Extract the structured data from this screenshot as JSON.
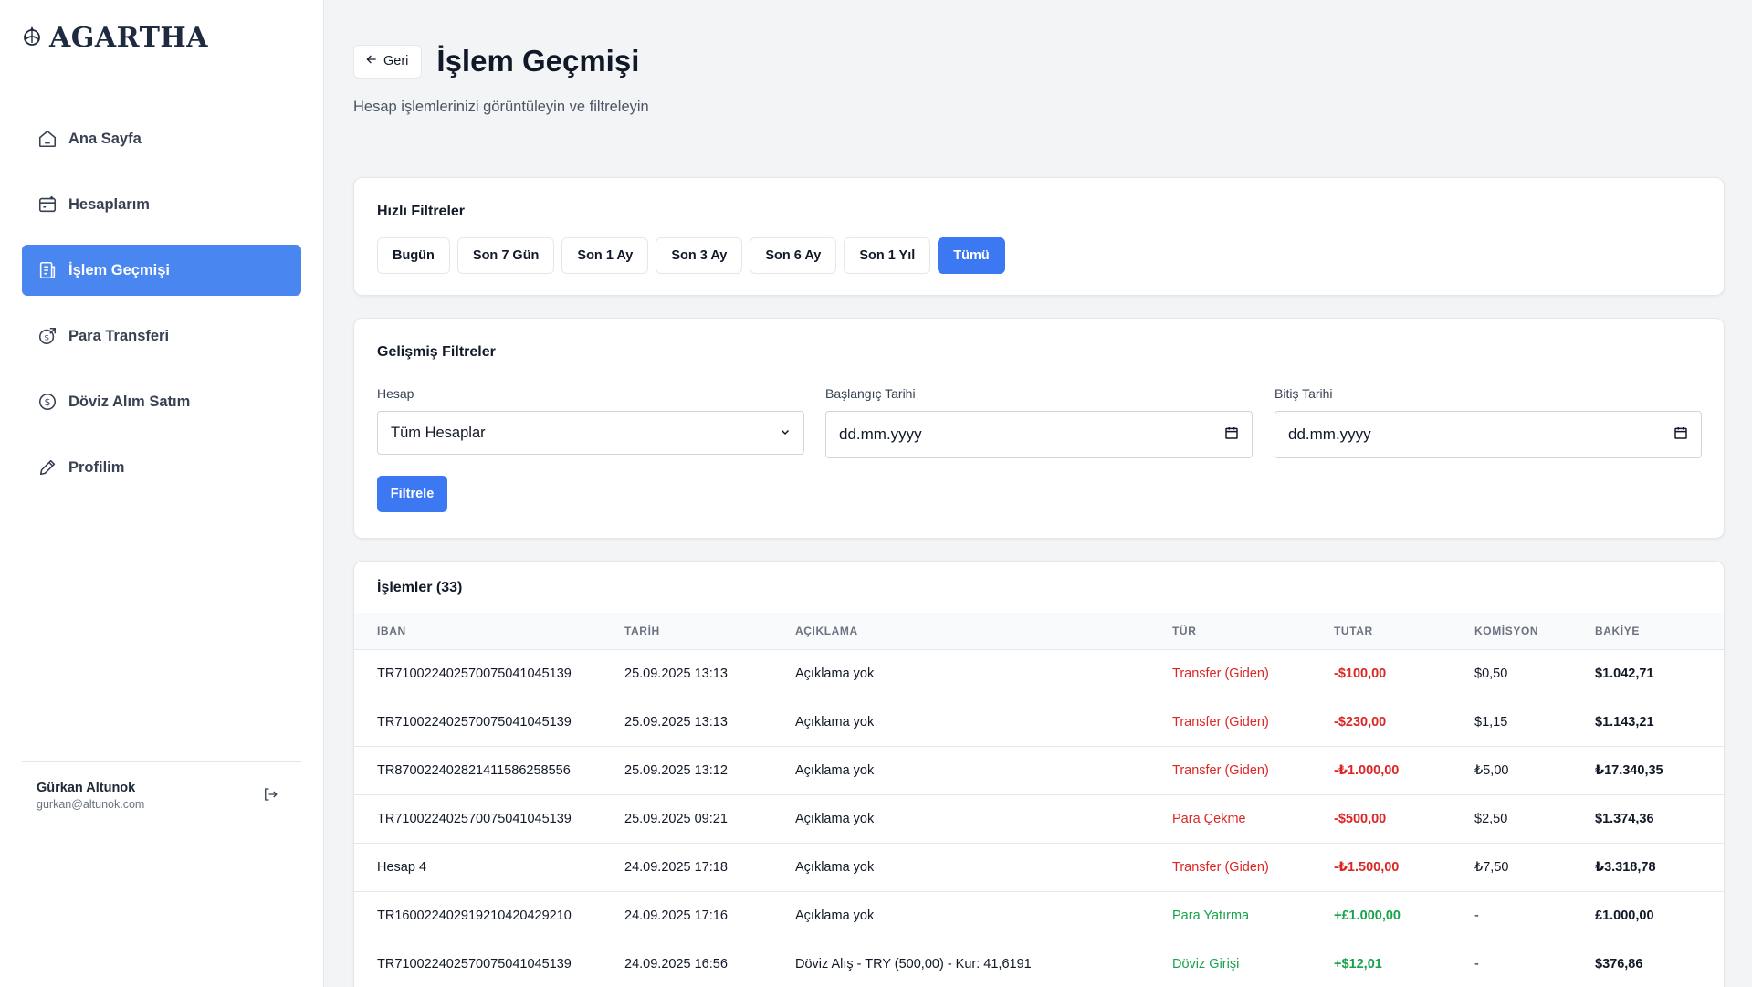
{
  "brand": {
    "name": "AGARTHA"
  },
  "sidebar": {
    "items": [
      {
        "label": "Ana Sayfa",
        "icon": "home-icon",
        "active": false
      },
      {
        "label": "Hesaplarım",
        "icon": "accounts-icon",
        "active": false
      },
      {
        "label": "İşlem Geçmişi",
        "icon": "receipt-icon",
        "active": true
      },
      {
        "label": "Para Transferi",
        "icon": "transfer-icon",
        "active": false
      },
      {
        "label": "Döviz Alım Satım",
        "icon": "dollar-icon",
        "active": false
      },
      {
        "label": "Profilim",
        "icon": "pencil-icon",
        "active": false
      }
    ]
  },
  "user": {
    "name": "Gürkan Altunok",
    "email": "gurkan@altunok.com"
  },
  "header": {
    "back_label": "Geri",
    "title": "İşlem Geçmişi",
    "subtitle": "Hesap işlemlerinizi görüntüleyin ve filtreleyin"
  },
  "quick_filters": {
    "title": "Hızlı Filtreler",
    "buttons": [
      "Bugün",
      "Son 7 Gün",
      "Son 1 Ay",
      "Son 3 Ay",
      "Son 6 Ay",
      "Son 1 Yıl",
      "Tümü"
    ],
    "selected": "Tümü"
  },
  "advanced_filters": {
    "title": "Gelişmiş Filtreler",
    "account_label": "Hesap",
    "account_value": "Tüm Hesaplar",
    "start_label": "Başlangıç Tarihi",
    "start_value": "dd.mm.yyyy",
    "end_label": "Bitiş Tarihi",
    "end_value": "dd.mm.yyyy",
    "submit_label": "Filtrele"
  },
  "transactions": {
    "title": "İşlemler (33)",
    "columns": [
      "IBAN",
      "TARİH",
      "AÇIKLAMA",
      "TÜR",
      "TUTAR",
      "KOMİSYON",
      "BAKİYE"
    ],
    "rows": [
      {
        "iban": "TR710022402570075041045139",
        "date": "25.09.2025 13:13",
        "desc": "Açıklama yok",
        "type": "Transfer (Giden)",
        "amount": "-$100,00",
        "fee": "$0,50",
        "balance": "$1.042,71",
        "direction": "out"
      },
      {
        "iban": "TR710022402570075041045139",
        "date": "25.09.2025 13:13",
        "desc": "Açıklama yok",
        "type": "Transfer (Giden)",
        "amount": "-$230,00",
        "fee": "$1,15",
        "balance": "$1.143,21",
        "direction": "out"
      },
      {
        "iban": "TR870022402821411586258556",
        "date": "25.09.2025 13:12",
        "desc": "Açıklama yok",
        "type": "Transfer (Giden)",
        "amount": "-₺1.000,00",
        "fee": "₺5,00",
        "balance": "₺17.340,35",
        "direction": "out"
      },
      {
        "iban": "TR710022402570075041045139",
        "date": "25.09.2025 09:21",
        "desc": "Açıklama yok",
        "type": "Para Çekme",
        "amount": "-$500,00",
        "fee": "$2,50",
        "balance": "$1.374,36",
        "direction": "out"
      },
      {
        "iban": "Hesap 4",
        "date": "24.09.2025 17:18",
        "desc": "Açıklama yok",
        "type": "Transfer (Giden)",
        "amount": "-₺1.500,00",
        "fee": "₺7,50",
        "balance": "₺3.318,78",
        "direction": "out"
      },
      {
        "iban": "TR160022402919210420429210",
        "date": "24.09.2025 17:16",
        "desc": "Açıklama yok",
        "type": "Para Yatırma",
        "amount": "+£1.000,00",
        "fee": "-",
        "balance": "£1.000,00",
        "direction": "in"
      },
      {
        "iban": "TR710022402570075041045139",
        "date": "24.09.2025 16:56",
        "desc": "Döviz Alış - TRY (500,00) - Kur: 41,6191",
        "type": "Döviz Girişi",
        "amount": "+$12,01",
        "fee": "-",
        "balance": "$376,86",
        "direction": "in"
      }
    ]
  },
  "colors": {
    "accent": "#3b78f2",
    "sidebar_active": "#4a86f0",
    "negative": "#dc2626",
    "positive": "#16a34a"
  }
}
